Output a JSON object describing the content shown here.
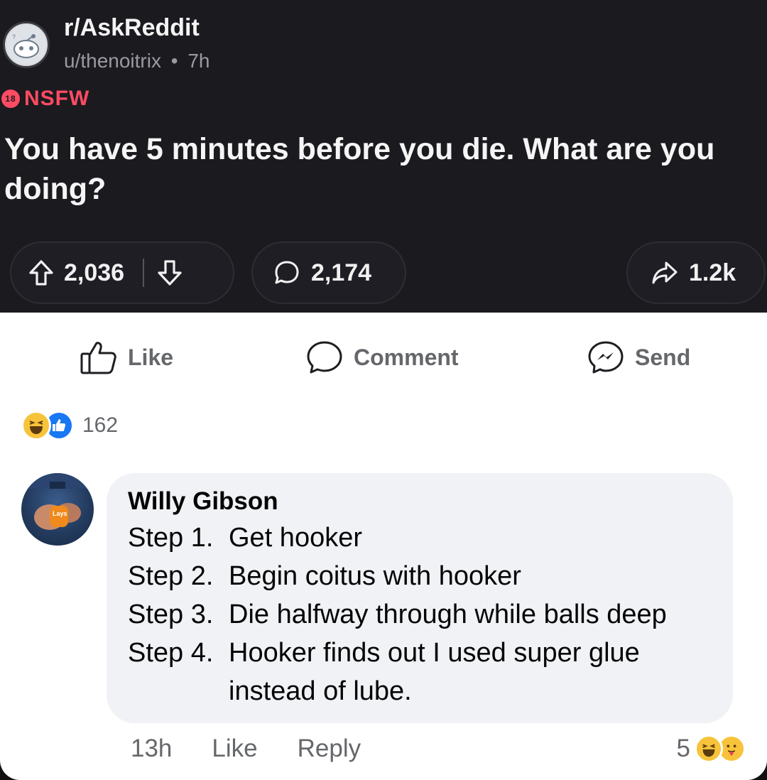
{
  "reddit_post": {
    "subreddit": "r/AskReddit",
    "user": "u/thenoitrix",
    "age": "7h",
    "separator": "•",
    "nsfw_label": "NSFW",
    "nsfw_badge": "18",
    "title": "You have 5 minutes before you die. What are you doing?",
    "upvotes": "2,036",
    "comments": "2,174",
    "shares": "1.2k",
    "accent_color": "#ff4b63"
  },
  "facebook": {
    "actions": {
      "like": "Like",
      "comment": "Comment",
      "send": "Send"
    },
    "reaction_count": "162",
    "comment": {
      "author": "Willy Gibson",
      "steps": [
        {
          "num": "Step 1.",
          "text": "Get hooker"
        },
        {
          "num": "Step 2.",
          "text": "Begin coitus with hooker"
        },
        {
          "num": "Step 3.",
          "text": "Die halfway through while balls deep"
        },
        {
          "num": "Step 4.",
          "text": "Hooker finds out I used super glue instead of lube."
        }
      ],
      "time": "13h",
      "like_label": "Like",
      "reply_label": "Reply",
      "reaction_count": "5"
    }
  }
}
